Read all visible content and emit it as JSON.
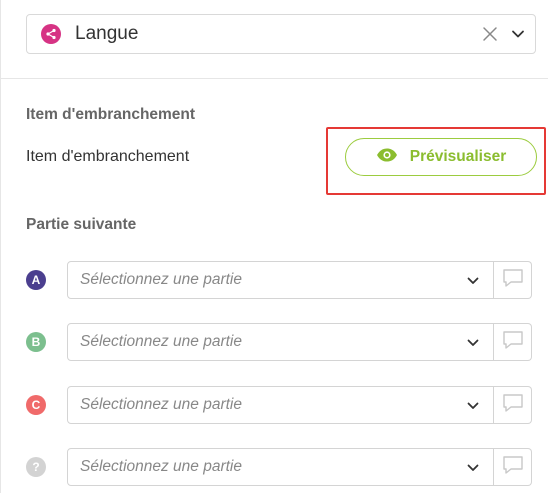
{
  "top_select": {
    "icon": "branch-icon",
    "value": "Langue",
    "accent": "#d63384"
  },
  "branch_item": {
    "section_title": "Item d'embranchement",
    "label": "Item d'embranchement",
    "preview_label": "Prévisualiser",
    "preview_color": "#8bbd2f",
    "highlight_color": "#e53935"
  },
  "next_part": {
    "section_title": "Partie suivante",
    "rows": [
      {
        "badge": "A",
        "color": "#4b3f8f",
        "placeholder": "Sélectionnez une partie"
      },
      {
        "badge": "B",
        "color": "#7cbf8e",
        "placeholder": "Sélectionnez une partie"
      },
      {
        "badge": "C",
        "color": "#f06a6a",
        "placeholder": "Sélectionnez une partie"
      },
      {
        "badge": "?",
        "color": "#d3d3d3",
        "placeholder": "Sélectionnez une partie"
      }
    ]
  }
}
